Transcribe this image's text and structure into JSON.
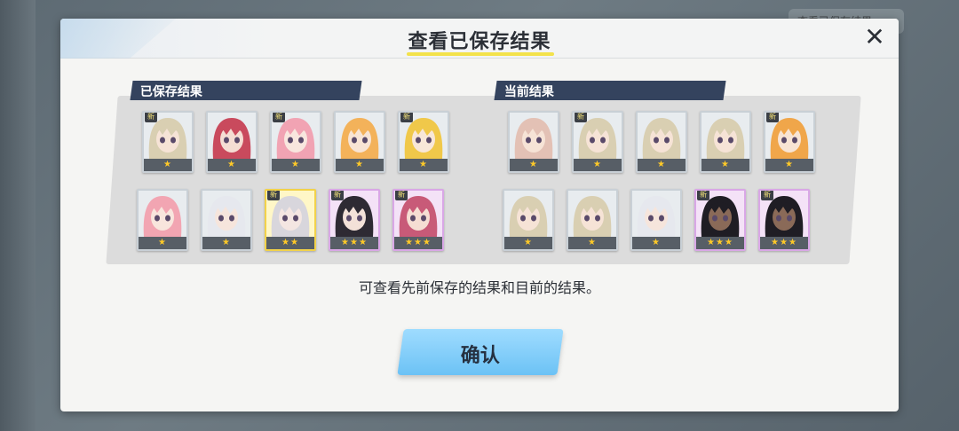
{
  "background": {
    "top_right_text": "查看已保存结果"
  },
  "modal": {
    "title": "查看已保存结果",
    "close_label": "✕",
    "caption": "可查看先前保存的结果和目前的结果。",
    "confirm_label": "确认"
  },
  "saved_panel": {
    "label": "已保存结果",
    "cards": [
      {
        "stars": "★",
        "rarity": 1,
        "new": true,
        "hair": "#d9cfb2",
        "face": "#f6e3d6"
      },
      {
        "stars": "★",
        "rarity": 1,
        "new": false,
        "hair": "#c94a5d",
        "face": "#f5ddd3"
      },
      {
        "stars": "★",
        "rarity": 1,
        "new": true,
        "hair": "#f1a3b3",
        "face": "#f8e6de"
      },
      {
        "stars": "★",
        "rarity": 1,
        "new": false,
        "hair": "#f3b25a",
        "face": "#f8e4d4"
      },
      {
        "stars": "★",
        "rarity": 1,
        "new": true,
        "hair": "#f0c84a",
        "face": "#f8e7d8"
      },
      {
        "stars": "★",
        "rarity": 1,
        "new": false,
        "hair": "#f2a5b2",
        "face": "#f8e5dd"
      },
      {
        "stars": "★",
        "rarity": 1,
        "new": false,
        "hair": "#e6e8ee",
        "face": "#f6e5dc"
      },
      {
        "stars": "★★",
        "rarity": 2,
        "new": true,
        "hair": "#d8d6dc",
        "face": "#f4e6e2"
      },
      {
        "stars": "★★★",
        "rarity": 3,
        "new": true,
        "hair": "#2e2a33",
        "face": "#f3e1d8"
      },
      {
        "stars": "★★★",
        "rarity": 3,
        "new": true,
        "hair": "#c85a78",
        "face": "#f5ddd3"
      }
    ]
  },
  "current_panel": {
    "label": "当前结果",
    "cards": [
      {
        "stars": "★",
        "rarity": 1,
        "new": false,
        "hair": "#e3c1b5",
        "face": "#f6e3d6"
      },
      {
        "stars": "★",
        "rarity": 1,
        "new": true,
        "hair": "#d9cfb2",
        "face": "#f6e3d6"
      },
      {
        "stars": "★",
        "rarity": 1,
        "new": false,
        "hair": "#d9cfb2",
        "face": "#f6e3d6"
      },
      {
        "stars": "★",
        "rarity": 1,
        "new": false,
        "hair": "#d9cfb2",
        "face": "#f6e3d6"
      },
      {
        "stars": "★",
        "rarity": 1,
        "new": true,
        "hair": "#f0a64a",
        "face": "#f8e4d4"
      },
      {
        "stars": "★",
        "rarity": 1,
        "new": false,
        "hair": "#d9cfb2",
        "face": "#f6e3d6"
      },
      {
        "stars": "★",
        "rarity": 1,
        "new": false,
        "hair": "#d9cfb2",
        "face": "#f6e3d6"
      },
      {
        "stars": "★",
        "rarity": 1,
        "new": false,
        "hair": "#e6e8ee",
        "face": "#f6e5dc"
      },
      {
        "stars": "★★★",
        "rarity": 3,
        "new": true,
        "hair": "#1f1d24",
        "face": "#8a6a58"
      },
      {
        "stars": "★★★",
        "rarity": 3,
        "new": true,
        "hair": "#1f1d24",
        "face": "#8a6a58"
      }
    ]
  },
  "new_badge_text": "新"
}
